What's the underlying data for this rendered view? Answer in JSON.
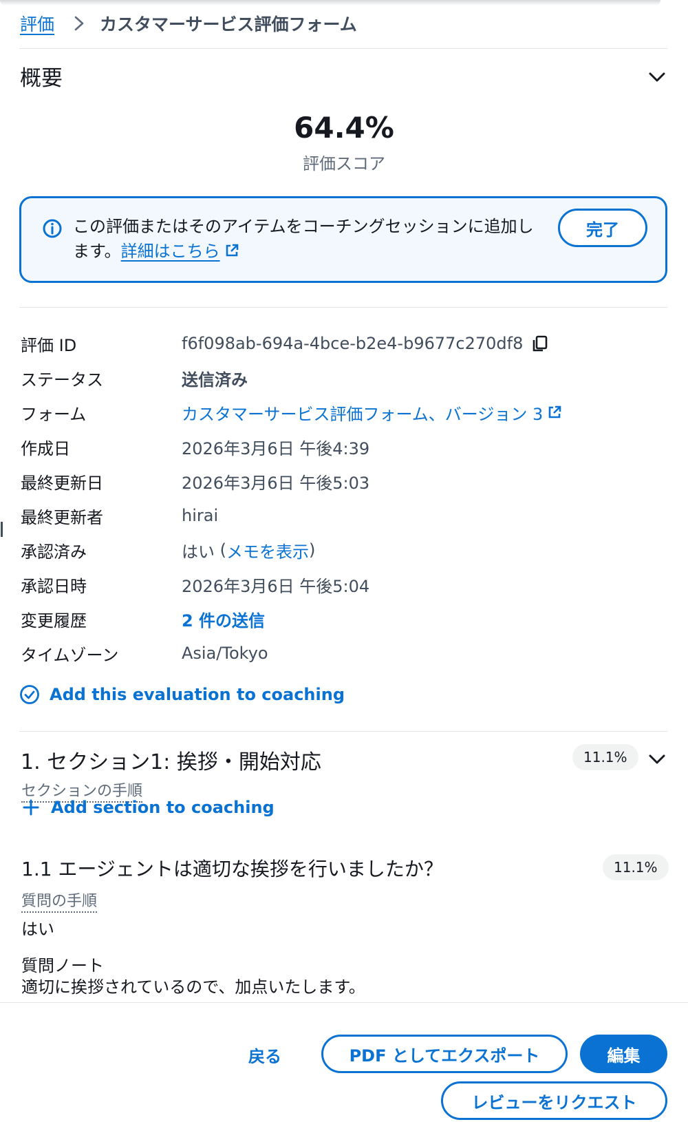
{
  "breadcrumb": {
    "root": "評価",
    "current": "カスタマーサービス評価フォーム"
  },
  "overview": {
    "title": "概要",
    "score_value": "64.4%",
    "score_label": "評価スコア"
  },
  "alert": {
    "text": "この評価またはそのアイテムをコーチングセッションに追加します。",
    "link": "詳細はこちら",
    "done_button": "完了"
  },
  "details": {
    "evaluation_id": {
      "label": "評価 ID",
      "value": "f6f098ab-694a-4bce-b2e4-b9677c270df8"
    },
    "status": {
      "label": "ステータス",
      "value": "送信済み"
    },
    "form": {
      "label": "フォーム",
      "value": "カスタマーサービス評価フォーム、バージョン 3"
    },
    "created": {
      "label": "作成日",
      "value": "2026年3月6日 午後4:39"
    },
    "last_updated": {
      "label": "最終更新日",
      "value": "2026年3月6日 午後5:03"
    },
    "last_updated_by": {
      "label": "最終更新者",
      "value": "hirai"
    },
    "approved": {
      "label": "承認済み",
      "value": "はい",
      "open_paren": "(",
      "link": "メモを表示",
      "close_paren": ")"
    },
    "approved_at": {
      "label": "承認日時",
      "value": "2026年3月6日 午後5:04"
    },
    "history": {
      "label": "変更履歴",
      "value": "2 件の送信"
    },
    "timezone": {
      "label": "タイムゾーン",
      "value": "Asia/Tokyo"
    }
  },
  "coaching_link": "Add this evaluation to coaching",
  "section": {
    "title": "1. セクション1: 挨拶・開始対応",
    "score": "11.1%",
    "instructions": "セクションの手順",
    "add_to_coaching": "Add section to coaching"
  },
  "question": {
    "title": "1.1 エージェントは適切な挨拶を行いましたか？",
    "score": "11.1%",
    "instructions": "質問の手順",
    "answer": "はい",
    "note_label": "質問ノート",
    "note": "適切に挨拶されているので、加点いたします。"
  },
  "footer": {
    "back": "戻る",
    "export": "PDF としてエクスポート",
    "edit": "編集",
    "request_review": "レビューをリクエスト"
  },
  "colors": {
    "accent": "#0972d3",
    "text": "#16191f",
    "muted": "#5f6b7a"
  }
}
